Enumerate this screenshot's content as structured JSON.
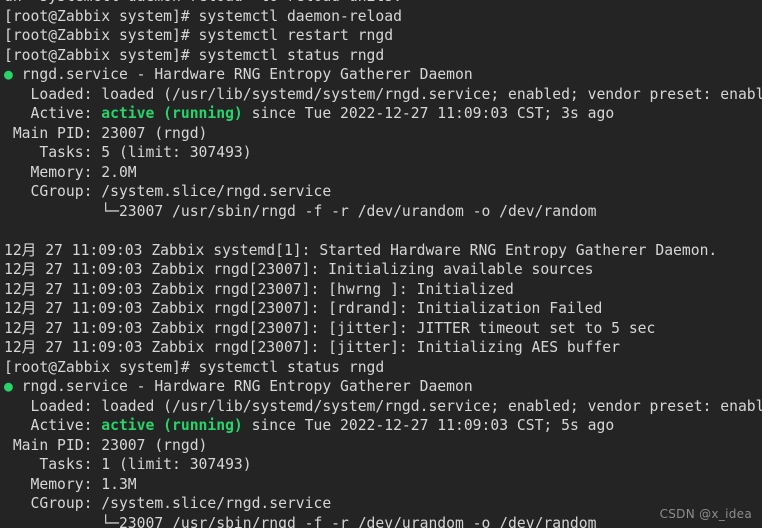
{
  "terminal": {
    "background_color": "#242424",
    "foreground_color": "#d6d6d6",
    "accent_color": "#26d46a",
    "prompt": "[root@Zabbix system]#",
    "hostname": "Zabbix",
    "user": "root",
    "lines": [
      {
        "id": "line-0-truncated-hint",
        "segments": [
          {
            "text": "un `systemctl daemon-reload` to reload units.",
            "style": "normal"
          }
        ]
      },
      {
        "id": "line-1-cmd-daemon-reload",
        "segments": [
          {
            "text": "[root@Zabbix system]# systemctl daemon-reload",
            "style": "normal"
          }
        ]
      },
      {
        "id": "line-2-cmd-restart-rngd",
        "segments": [
          {
            "text": "[root@Zabbix system]# systemctl restart rngd",
            "style": "normal"
          }
        ]
      },
      {
        "id": "line-3-cmd-status-rngd-1",
        "segments": [
          {
            "text": "[root@Zabbix system]# systemctl status rngd",
            "style": "normal"
          }
        ]
      },
      {
        "id": "line-4-unit-header-1",
        "segments": [
          {
            "text": "●",
            "style": "bullet"
          },
          {
            "text": " rngd.service - Hardware RNG Entropy Gatherer Daemon",
            "style": "normal"
          }
        ]
      },
      {
        "id": "line-5-loaded-1",
        "segments": [
          {
            "text": "   Loaded: loaded (/usr/lib/systemd/system/rngd.service; enabled; vendor preset: enabled)",
            "style": "normal"
          }
        ]
      },
      {
        "id": "line-6-active-1",
        "segments": [
          {
            "text": "   Active: ",
            "style": "normal"
          },
          {
            "text": "active (running)",
            "style": "ok"
          },
          {
            "text": " since Tue 2022-12-27 11:09:03 CST; 3s ago",
            "style": "normal"
          }
        ]
      },
      {
        "id": "line-7-mainpid-1",
        "segments": [
          {
            "text": " Main PID: 23007 (rngd)",
            "style": "normal"
          }
        ]
      },
      {
        "id": "line-8-tasks-1",
        "segments": [
          {
            "text": "    Tasks: 5 (limit: 307493)",
            "style": "normal"
          }
        ]
      },
      {
        "id": "line-9-memory-1",
        "segments": [
          {
            "text": "   Memory: 2.0M",
            "style": "normal"
          }
        ]
      },
      {
        "id": "line-10-cgroup-1",
        "segments": [
          {
            "text": "   CGroup: /system.slice/rngd.service",
            "style": "normal"
          }
        ]
      },
      {
        "id": "line-11-cgroup-proc-1",
        "segments": [
          {
            "text": "           └─23007 /usr/sbin/rngd -f -r /dev/urandom -o /dev/random",
            "style": "normal"
          }
        ]
      },
      {
        "id": "line-12-blank-1",
        "segments": [
          {
            "text": " ",
            "style": "normal"
          }
        ]
      },
      {
        "id": "line-13-journal-started",
        "segments": [
          {
            "text": "12月 27 11:09:03 Zabbix systemd[1]: Started Hardware RNG Entropy Gatherer Daemon.",
            "style": "normal"
          }
        ]
      },
      {
        "id": "line-14-journal-init-sources",
        "segments": [
          {
            "text": "12月 27 11:09:03 Zabbix rngd[23007]: Initializing available sources",
            "style": "normal"
          }
        ]
      },
      {
        "id": "line-15-journal-hwrng",
        "segments": [
          {
            "text": "12月 27 11:09:03 Zabbix rngd[23007]: [hwrng ]: Initialized",
            "style": "normal"
          }
        ]
      },
      {
        "id": "line-16-journal-rdrand",
        "segments": [
          {
            "text": "12月 27 11:09:03 Zabbix rngd[23007]: [rdrand]: Initialization Failed",
            "style": "normal"
          }
        ]
      },
      {
        "id": "line-17-journal-jitter-timeout",
        "segments": [
          {
            "text": "12月 27 11:09:03 Zabbix rngd[23007]: [jitter]: JITTER timeout set to 5 sec",
            "style": "normal"
          }
        ]
      },
      {
        "id": "line-18-journal-jitter-aes",
        "segments": [
          {
            "text": "12月 27 11:09:03 Zabbix rngd[23007]: [jitter]: Initializing AES buffer",
            "style": "normal"
          }
        ]
      },
      {
        "id": "line-19-cmd-status-rngd-2",
        "segments": [
          {
            "text": "[root@Zabbix system]# systemctl status rngd",
            "style": "normal"
          }
        ]
      },
      {
        "id": "line-20-unit-header-2",
        "segments": [
          {
            "text": "●",
            "style": "bullet"
          },
          {
            "text": " rngd.service - Hardware RNG Entropy Gatherer Daemon",
            "style": "normal"
          }
        ]
      },
      {
        "id": "line-21-loaded-2",
        "segments": [
          {
            "text": "   Loaded: loaded (/usr/lib/systemd/system/rngd.service; enabled; vendor preset: enabled)",
            "style": "normal"
          }
        ]
      },
      {
        "id": "line-22-active-2",
        "segments": [
          {
            "text": "   Active: ",
            "style": "normal"
          },
          {
            "text": "active (running)",
            "style": "ok"
          },
          {
            "text": " since Tue 2022-12-27 11:09:03 CST; 5s ago",
            "style": "normal"
          }
        ]
      },
      {
        "id": "line-23-mainpid-2",
        "segments": [
          {
            "text": " Main PID: 23007 (rngd)",
            "style": "normal"
          }
        ]
      },
      {
        "id": "line-24-tasks-2",
        "segments": [
          {
            "text": "    Tasks: 1 (limit: 307493)",
            "style": "normal"
          }
        ]
      },
      {
        "id": "line-25-memory-2",
        "segments": [
          {
            "text": "   Memory: 1.3M",
            "style": "normal"
          }
        ]
      },
      {
        "id": "line-26-cgroup-2",
        "segments": [
          {
            "text": "   CGroup: /system.slice/rngd.service",
            "style": "normal"
          }
        ]
      },
      {
        "id": "line-27-cgroup-proc-2",
        "segments": [
          {
            "text": "           └─23007 /usr/sbin/rngd -f -r /dev/urandom -o /dev/random",
            "style": "normal"
          }
        ]
      }
    ]
  },
  "watermark": {
    "text": "CSDN @x_idea"
  }
}
